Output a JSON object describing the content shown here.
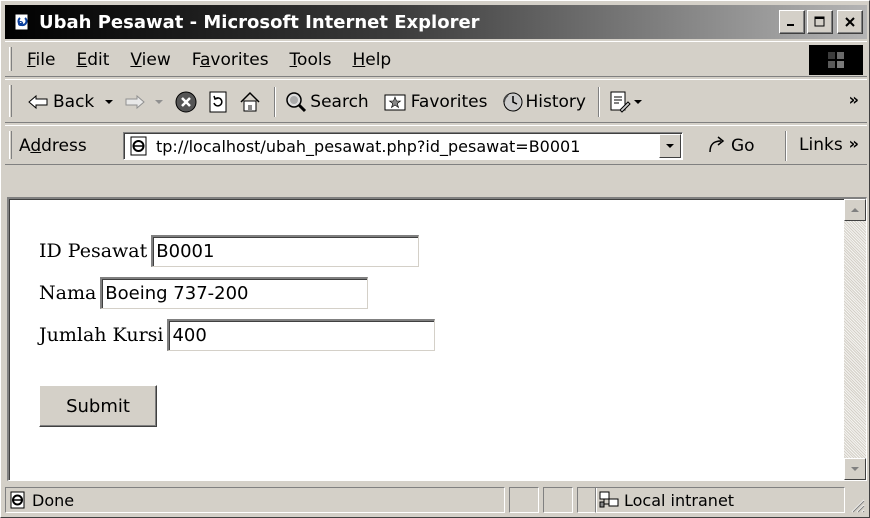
{
  "window": {
    "title": "Ubah Pesawat - Microsoft Internet Explorer",
    "buttons": {
      "minimize": "_",
      "maximize": "□",
      "close": "×"
    }
  },
  "menubar": {
    "items": [
      {
        "label": "File",
        "accel": "F",
        "rest": "ile"
      },
      {
        "label": "Edit",
        "accel": "E",
        "rest": "dit"
      },
      {
        "label": "View",
        "accel": "V",
        "rest": "iew"
      },
      {
        "label": "Favorites",
        "pre": "F",
        "accel": "a",
        "rest": "vorites"
      },
      {
        "label": "Tools",
        "accel": "T",
        "rest": "ools"
      },
      {
        "label": "Help",
        "accel": "H",
        "rest": "elp"
      }
    ]
  },
  "toolbar": {
    "back_label": "Back",
    "search_label": "Search",
    "favorites_label": "Favorites",
    "history_label": "History",
    "more": "»"
  },
  "addressbar": {
    "label_pre": "A",
    "label_accel": "d",
    "label_rest": "dress",
    "url": "tp://localhost/ubah_pesawat.php?id_pesawat=B0001",
    "go_label": "Go",
    "links_label": "Links",
    "more": "»"
  },
  "form": {
    "id_label": "ID Pesawat",
    "id_value": "B0001",
    "nama_label": "Nama",
    "nama_value": "Boeing 737-200",
    "kursi_label": "Jumlah Kursi",
    "kursi_value": "400",
    "submit_label": "Submit"
  },
  "statusbar": {
    "status_text": "Done",
    "zone_text": "Local intranet"
  },
  "colors": {
    "face": "#d4d0c8",
    "title_start": "#000000",
    "title_end": "#b4b4b4"
  }
}
